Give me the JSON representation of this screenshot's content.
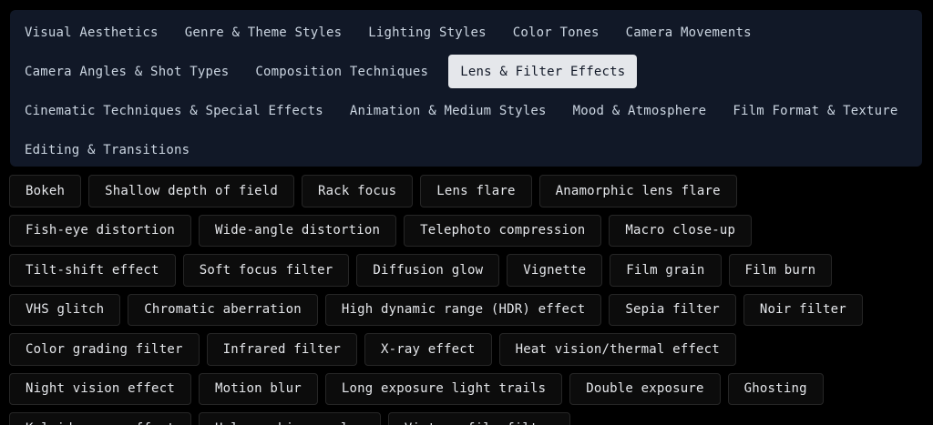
{
  "categories": [
    {
      "label": "Visual Aesthetics",
      "active": false
    },
    {
      "label": "Genre & Theme Styles",
      "active": false
    },
    {
      "label": "Lighting Styles",
      "active": false
    },
    {
      "label": "Color Tones",
      "active": false
    },
    {
      "label": "Camera Movements",
      "active": false
    },
    {
      "label": "Camera Angles & Shot Types",
      "active": false
    },
    {
      "label": "Composition Techniques",
      "active": false
    },
    {
      "label": "Lens & Filter Effects",
      "active": true
    },
    {
      "label": "Cinematic Techniques & Special Effects",
      "active": false
    },
    {
      "label": "Animation & Medium Styles",
      "active": false
    },
    {
      "label": "Mood & Atmosphere",
      "active": false
    },
    {
      "label": "Film Format & Texture",
      "active": false
    },
    {
      "label": "Editing & Transitions",
      "active": false
    }
  ],
  "effects": [
    "Bokeh",
    "Shallow depth of field",
    "Rack focus",
    "Lens flare",
    "Anamorphic lens flare",
    "Fish-eye distortion",
    "Wide-angle distortion",
    "Telephoto compression",
    "Macro close-up",
    "Tilt-shift effect",
    "Soft focus filter",
    "Diffusion glow",
    "Vignette",
    "Film grain",
    "Film burn",
    "VHS glitch",
    "Chromatic aberration",
    "High dynamic range (HDR) effect",
    "Sepia filter",
    "Noir filter",
    "Color grading filter",
    "Infrared filter",
    "X-ray effect",
    "Heat vision/thermal effect",
    "Night vision effect",
    "Motion blur",
    "Long exposure light trails",
    "Double exposure",
    "Ghosting",
    "Kaleidoscope effect",
    "Holographic overlay",
    "Vintage film filter"
  ]
}
